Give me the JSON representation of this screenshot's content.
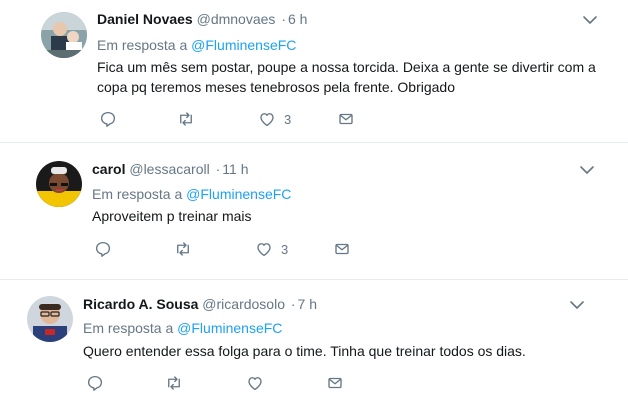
{
  "reply_prefix": "Em resposta a",
  "tweets": [
    {
      "name": "Daniel Novaes",
      "handle": "@dmnovaes",
      "dot": "·",
      "time": "6 h",
      "reply_to": "@FluminenseFC",
      "text_lines": [
        "Fica um mês sem postar, poupe a nossa torcida. Deixa a gente se divertir com a",
        "copa pq teremos meses tenebrosos pela frente. Obrigado"
      ],
      "likes": "3"
    },
    {
      "name": "carol",
      "handle": "@lessacaroll",
      "dot": "·",
      "time": "11 h",
      "reply_to": "@FluminenseFC",
      "text_lines": [
        "Aproveitem p treinar mais"
      ],
      "likes": "3"
    },
    {
      "name": "Ricardo A. Sousa",
      "handle": "@ricardosolo",
      "dot": "·",
      "time": "7 h",
      "reply_to": "@FluminenseFC",
      "text_lines": [
        "Quero entender essa folga para o time. Tinha que treinar todos os dias."
      ],
      "likes": ""
    }
  ],
  "colors": {
    "link": "#1da1f2",
    "muted": "#657786",
    "text": "#14171a",
    "divider": "#e6ecf0"
  },
  "icons": {
    "reply": "reply-icon",
    "retweet": "retweet-icon",
    "like": "heart-icon",
    "dm": "envelope-icon",
    "caret": "chevron-down-icon"
  }
}
